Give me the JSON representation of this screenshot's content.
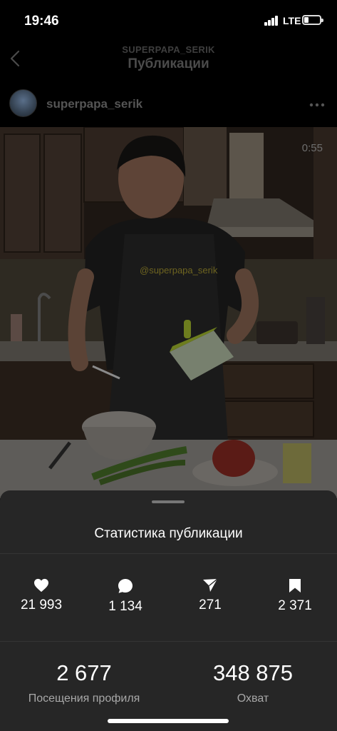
{
  "status_bar": {
    "time": "19:46",
    "network": "LTE"
  },
  "header": {
    "subtitle": "SUPERPAPA_SERIK",
    "title": "Публикации"
  },
  "post": {
    "username": "superpapa_serik",
    "video_duration": "0:55",
    "apron_text": "@superpapa_serik"
  },
  "insights": {
    "title": "Статистика публикации",
    "metrics": [
      {
        "icon": "heart-icon",
        "value": "21 993"
      },
      {
        "icon": "comment-icon",
        "value": "1 134"
      },
      {
        "icon": "share-icon",
        "value": "271"
      },
      {
        "icon": "bookmark-icon",
        "value": "2 371"
      }
    ],
    "profile_visits": {
      "value": "2 677",
      "label": "Посещения профиля"
    },
    "reach": {
      "value": "348 875",
      "label": "Охват"
    }
  }
}
